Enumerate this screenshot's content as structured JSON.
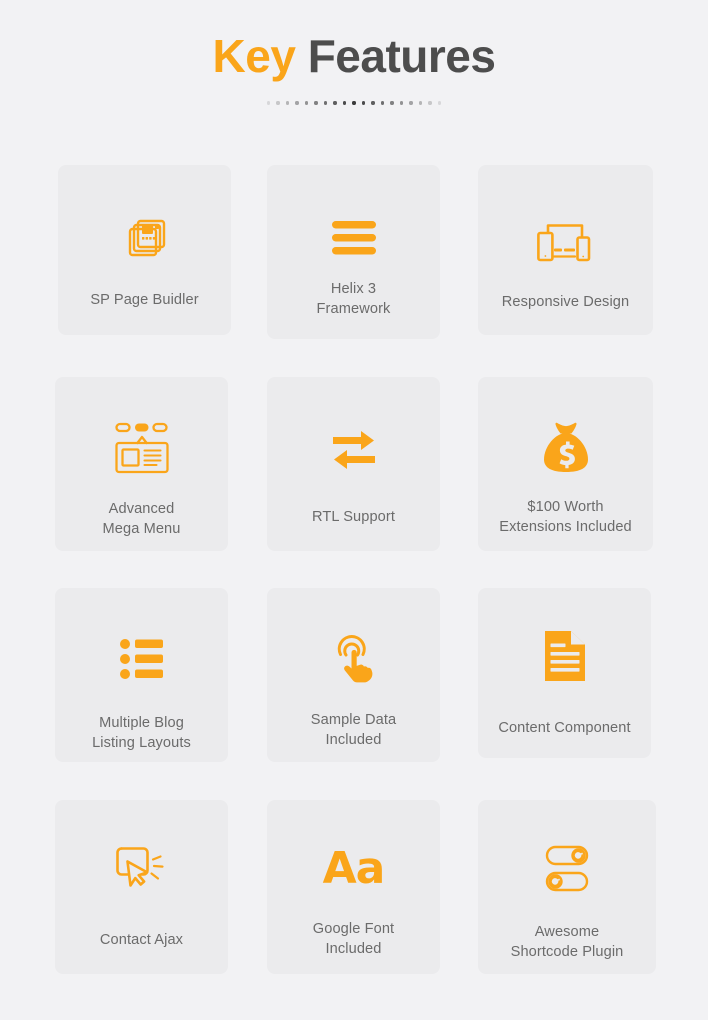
{
  "header": {
    "title_accent": "Key",
    "title_rest": " Features",
    "divider_dot_count": 19
  },
  "theme": {
    "accent_color": "#faa51a",
    "page_background": "#f2f2f4",
    "card_background": "#ebebed",
    "title_color": "#4d4d4d",
    "label_color": "#6b6b6b"
  },
  "features": [
    {
      "id": 0,
      "label": "SP Page Buidler",
      "icon": "stacked-pages-icon"
    },
    {
      "id": 1,
      "label": "Helix 3\nFramework",
      "icon": "hamburger-bars-icon"
    },
    {
      "id": 2,
      "label": "Responsive Design",
      "icon": "responsive-devices-icon"
    },
    {
      "id": 3,
      "label": "Advanced\nMega Menu",
      "icon": "mega-menu-icon"
    },
    {
      "id": 4,
      "label": "RTL Support",
      "icon": "exchange-arrows-icon"
    },
    {
      "id": 5,
      "label": "$100 Worth\nExtensions Included",
      "icon": "money-bag-icon"
    },
    {
      "id": 6,
      "label": "Multiple Blog\nListing Layouts",
      "icon": "bulleted-list-icon"
    },
    {
      "id": 7,
      "label": "Sample Data\nIncluded",
      "icon": "tap-gesture-icon"
    },
    {
      "id": 8,
      "label": "Content Component",
      "icon": "document-icon"
    },
    {
      "id": 9,
      "label": "Contact Ajax",
      "icon": "cursor-click-icon"
    },
    {
      "id": 10,
      "label": "Google Font\nIncluded",
      "icon": "typography-aa-icon"
    },
    {
      "id": 11,
      "label": "Awesome\nShortcode Plugin",
      "icon": "toggle-switches-icon"
    }
  ]
}
